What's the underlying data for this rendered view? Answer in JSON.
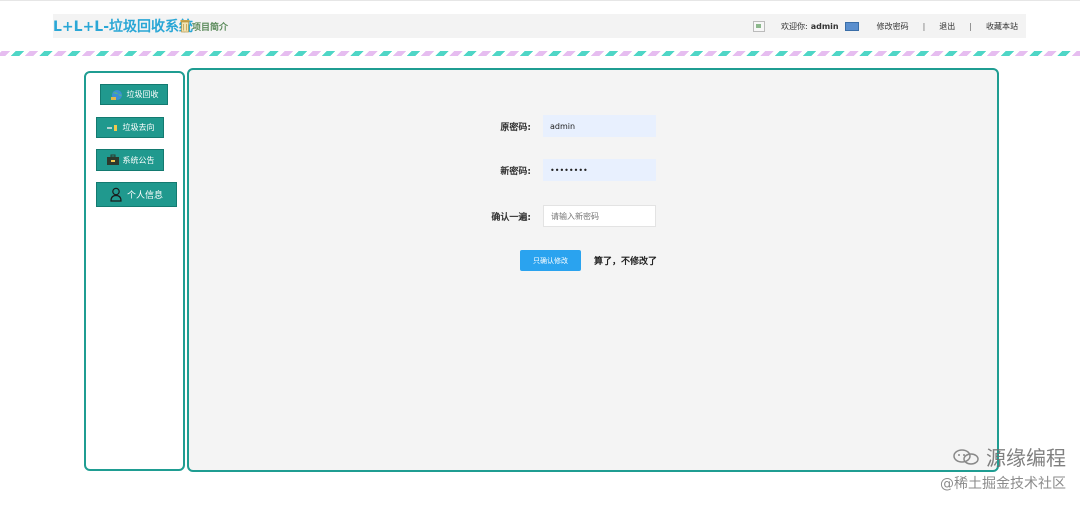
{
  "header": {
    "brand": "L+L+L-垃圾回收系统",
    "intro": "项目简介",
    "welcome": "欢迎你:",
    "username": "admin",
    "links": [
      "修改密码",
      "退出",
      "收藏本站"
    ],
    "separator": "|"
  },
  "sidebar": {
    "items": [
      {
        "label": "垃圾回收",
        "icon": "globe-icon"
      },
      {
        "label": "垃圾去向",
        "icon": "arrow-icon"
      },
      {
        "label": "系统公告",
        "icon": "briefcase-icon"
      },
      {
        "label": "个人信息",
        "icon": "user-icon"
      }
    ]
  },
  "form": {
    "old_password_label": "原密码:",
    "old_password_value": "admin",
    "new_password_label": "新密码:",
    "new_password_value": "••••••••",
    "confirm_label": "确认一遍:",
    "confirm_placeholder": "请输入新密码",
    "submit_label": "只确认修改",
    "cancel_label": "算了，不修改了"
  },
  "watermark": {
    "line1": "源缘编程",
    "line2": "@稀土掘金技术社区"
  },
  "colors": {
    "accent": "#20998e",
    "brand": "#2aa7d6",
    "button": "#2aa3ef"
  }
}
